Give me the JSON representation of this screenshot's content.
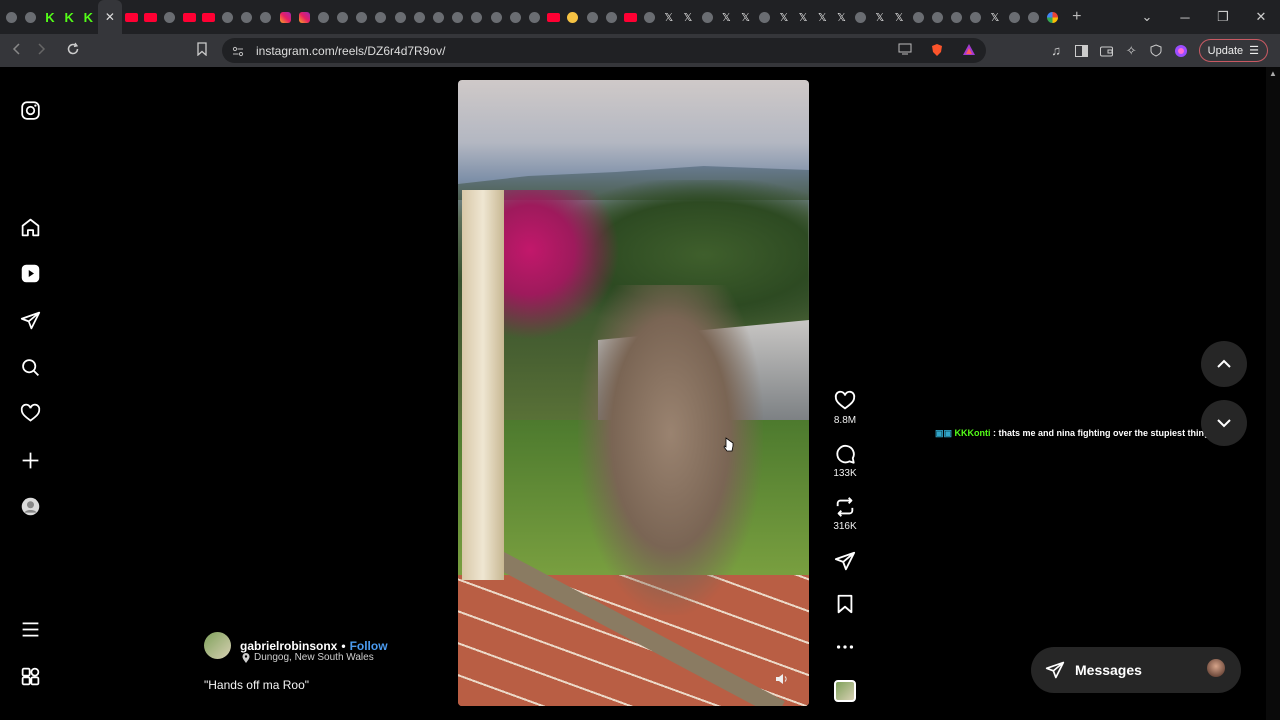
{
  "browser": {
    "tabs": [
      {
        "icon": "generic-icon"
      },
      {
        "icon": "generic-icon"
      },
      {
        "icon": "kick-icon",
        "text": "K"
      },
      {
        "icon": "kick-icon",
        "text": "K"
      },
      {
        "icon": "kick-icon",
        "text": "K"
      },
      {
        "icon": "close-tab-icon",
        "text": "✕",
        "active": true
      },
      {
        "icon": "youtube-icon"
      },
      {
        "icon": "youtube-icon"
      },
      {
        "icon": "generic-icon"
      },
      {
        "icon": "youtube-icon"
      },
      {
        "icon": "youtube-icon"
      },
      {
        "icon": "generic-icon"
      },
      {
        "icon": "generic-icon"
      },
      {
        "icon": "generic-icon"
      },
      {
        "icon": "instagram-icon"
      },
      {
        "icon": "instagram-icon"
      },
      {
        "icon": "generic-icon"
      },
      {
        "icon": "generic-icon"
      },
      {
        "icon": "generic-icon"
      },
      {
        "icon": "generic-icon"
      },
      {
        "icon": "generic-icon"
      },
      {
        "icon": "generic-icon"
      },
      {
        "icon": "generic-icon"
      },
      {
        "icon": "generic-icon"
      },
      {
        "icon": "generic-icon"
      },
      {
        "icon": "generic-icon"
      },
      {
        "icon": "generic-icon"
      },
      {
        "icon": "generic-icon"
      },
      {
        "icon": "youtube-icon"
      },
      {
        "icon": "emoji-icon"
      },
      {
        "icon": "generic-icon"
      },
      {
        "icon": "generic-icon"
      },
      {
        "icon": "youtube-icon"
      },
      {
        "icon": "generic-icon"
      },
      {
        "icon": "x-icon",
        "text": "𝕏"
      },
      {
        "icon": "x-icon",
        "text": "𝕏"
      },
      {
        "icon": "generic-icon"
      },
      {
        "icon": "x-icon",
        "text": "𝕏"
      },
      {
        "icon": "x-icon",
        "text": "𝕏"
      },
      {
        "icon": "generic-icon"
      },
      {
        "icon": "x-icon",
        "text": "𝕏"
      },
      {
        "icon": "x-icon",
        "text": "𝕏"
      },
      {
        "icon": "x-icon",
        "text": "𝕏"
      },
      {
        "icon": "x-icon",
        "text": "𝕏"
      },
      {
        "icon": "generic-icon"
      },
      {
        "icon": "x-icon",
        "text": "𝕏"
      },
      {
        "icon": "x-icon",
        "text": "𝕏"
      },
      {
        "icon": "generic-icon"
      },
      {
        "icon": "generic-icon"
      },
      {
        "icon": "generic-icon"
      },
      {
        "icon": "generic-icon"
      },
      {
        "icon": "x-icon",
        "text": "𝕏"
      },
      {
        "icon": "generic-icon"
      },
      {
        "icon": "generic-icon"
      },
      {
        "icon": "google-icon"
      }
    ],
    "new_tab": "+",
    "window_controls": {
      "menu": "⌄",
      "minimize": "─",
      "restore": "❐",
      "close": "✕"
    },
    "url": "instagram.com/reels/DZ6r4d7R9ov/",
    "update_label": "Update",
    "colors": {
      "tabstrip": "#202124",
      "toolbar": "#35363a",
      "update_border": "#c95a63"
    }
  },
  "reel": {
    "likes": "8.8M",
    "comments": "133K",
    "reposts": "316K",
    "author": "gabrielrobinsonx",
    "separator": "•",
    "follow": "Follow",
    "location": "Dungog, New South Wales",
    "caption": "\"Hands off ma Roo\""
  },
  "overlay_chat": {
    "user": "KKKonti",
    "message": ": thats me and nina fighting over the stupiest things"
  },
  "messages": {
    "label": "Messages"
  },
  "colors": {
    "follow": "#4b9bf0",
    "chat_user": "#53fc18",
    "chat_badge": "#2fa4c8",
    "pill_bg": "#262626"
  }
}
